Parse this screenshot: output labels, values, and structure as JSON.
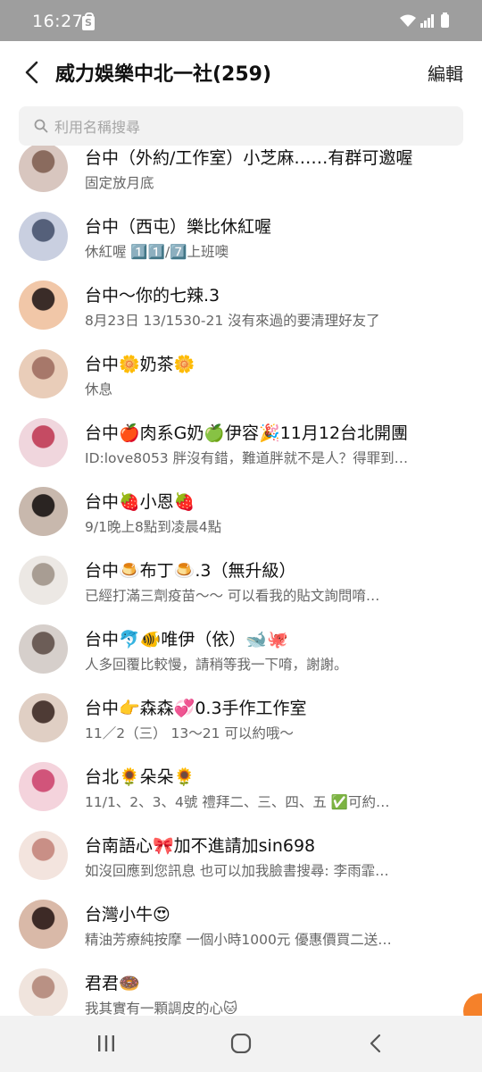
{
  "status_bar": {
    "time": "16:27",
    "notification_icon": "shopping-bag-s-icon"
  },
  "header": {
    "title": "威力娛樂中北一社(259)",
    "edit_label": "編輯"
  },
  "search": {
    "placeholder": "利用名稱搜尋",
    "value": ""
  },
  "contacts": [
    {
      "name": "台中（外約/工作室）小芝麻……有群可邀喔",
      "preview": "固定放月底",
      "avatar_colors": [
        "#d8c6bf",
        "#8a6b5e"
      ]
    },
    {
      "name": "台中（西屯）樂比休紅喔",
      "preview": "休紅喔 1️⃣1️⃣/7️⃣上班噢",
      "avatar_colors": [
        "#c9cfe0",
        "#55607a"
      ]
    },
    {
      "name": "台中～你的七辣.3",
      "preview": "8月23日 13/1530-21  沒有來過的要清理好友了",
      "avatar_colors": [
        "#f1c7a8",
        "#3a2c28"
      ]
    },
    {
      "name": "台中🌼奶茶🌼",
      "preview": "休息",
      "avatar_colors": [
        "#e9cdb9",
        "#a7786a"
      ]
    },
    {
      "name": "台中🍎肉系G奶🍏伊容🎉11月12台北開團",
      "preview": "ID:love8053 胖沒有錯，難道胖就不是人？得罪到…",
      "avatar_colors": [
        "#f0d6dd",
        "#c54b63"
      ]
    },
    {
      "name": "台中🍓小恩🍓",
      "preview": "9/1晚上8點到凌晨4點",
      "avatar_colors": [
        "#c8b8ad",
        "#2a2422"
      ]
    },
    {
      "name": "台中🍮布丁🍮.3（無升級）",
      "preview": "已經打滿三劑疫苗～～  可以看我的貼文詢問唷…",
      "avatar_colors": [
        "#ece8e4",
        "#a89d93"
      ]
    },
    {
      "name": "台中🐬🐠唯伊（依）🐋🐙",
      "preview": "人多回覆比較慢，請稍等我一下唷，謝謝。",
      "avatar_colors": [
        "#d6cfcb",
        "#6c5d57"
      ]
    },
    {
      "name": "台中👉森森💞0.3手作工作室",
      "preview": "11／2（三） 13～21 可以約哦～",
      "avatar_colors": [
        "#e0cfc4",
        "#4e3b35"
      ]
    },
    {
      "name": "台北🌻朵朵🌻",
      "preview": "11/1、2、3、4號 禮拜二、三、四、五 ✅可約…",
      "avatar_colors": [
        "#f4d3dc",
        "#d1547a"
      ]
    },
    {
      "name": "台南語心🎀加不進請加sin698",
      "preview": "如沒回應到您訊息  也可以加我臉書搜尋: 李雨霏…",
      "avatar_colors": [
        "#f3e4de",
        "#c98f86"
      ]
    },
    {
      "name": "台灣小牛😍",
      "preview": "精油芳療純按摩 一個小時1000元 優惠價買二送…",
      "avatar_colors": [
        "#d9b9a8",
        "#3d2a26"
      ]
    },
    {
      "name": "君君🍩",
      "preview": "我其實有一顆調皮的心🐱",
      "avatar_colors": [
        "#f0e4dd",
        "#b99184"
      ]
    }
  ],
  "colors": {
    "status_bar": "#9e9e9e",
    "accent_badge": "#f5812a",
    "nav_bar": "#f2f2f2"
  }
}
